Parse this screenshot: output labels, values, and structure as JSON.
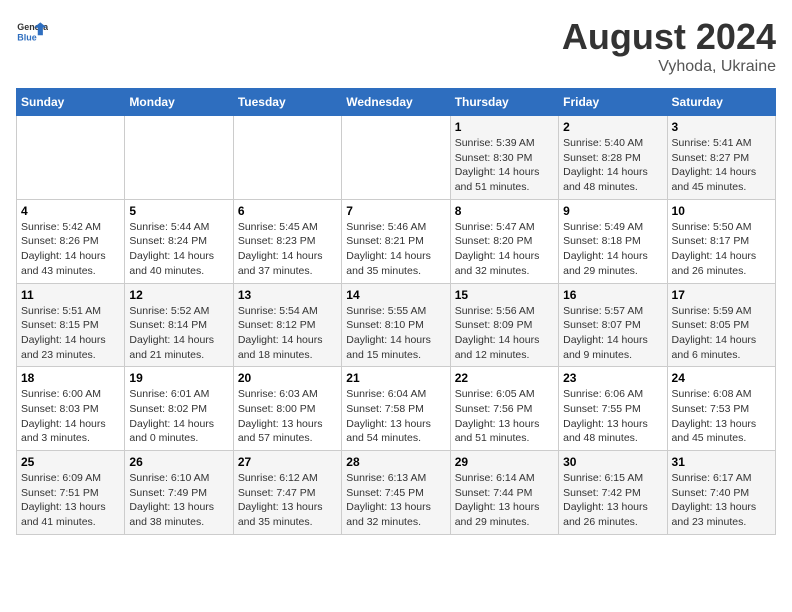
{
  "header": {
    "title": "August 2024",
    "subtitle": "Vyhoda, Ukraine",
    "logo_line1": "General",
    "logo_line2": "Blue"
  },
  "days_of_week": [
    "Sunday",
    "Monday",
    "Tuesday",
    "Wednesday",
    "Thursday",
    "Friday",
    "Saturday"
  ],
  "weeks": [
    [
      {
        "day": "",
        "info": ""
      },
      {
        "day": "",
        "info": ""
      },
      {
        "day": "",
        "info": ""
      },
      {
        "day": "",
        "info": ""
      },
      {
        "day": "1",
        "info": "Sunrise: 5:39 AM\nSunset: 8:30 PM\nDaylight: 14 hours\nand 51 minutes."
      },
      {
        "day": "2",
        "info": "Sunrise: 5:40 AM\nSunset: 8:28 PM\nDaylight: 14 hours\nand 48 minutes."
      },
      {
        "day": "3",
        "info": "Sunrise: 5:41 AM\nSunset: 8:27 PM\nDaylight: 14 hours\nand 45 minutes."
      }
    ],
    [
      {
        "day": "4",
        "info": "Sunrise: 5:42 AM\nSunset: 8:26 PM\nDaylight: 14 hours\nand 43 minutes."
      },
      {
        "day": "5",
        "info": "Sunrise: 5:44 AM\nSunset: 8:24 PM\nDaylight: 14 hours\nand 40 minutes."
      },
      {
        "day": "6",
        "info": "Sunrise: 5:45 AM\nSunset: 8:23 PM\nDaylight: 14 hours\nand 37 minutes."
      },
      {
        "day": "7",
        "info": "Sunrise: 5:46 AM\nSunset: 8:21 PM\nDaylight: 14 hours\nand 35 minutes."
      },
      {
        "day": "8",
        "info": "Sunrise: 5:47 AM\nSunset: 8:20 PM\nDaylight: 14 hours\nand 32 minutes."
      },
      {
        "day": "9",
        "info": "Sunrise: 5:49 AM\nSunset: 8:18 PM\nDaylight: 14 hours\nand 29 minutes."
      },
      {
        "day": "10",
        "info": "Sunrise: 5:50 AM\nSunset: 8:17 PM\nDaylight: 14 hours\nand 26 minutes."
      }
    ],
    [
      {
        "day": "11",
        "info": "Sunrise: 5:51 AM\nSunset: 8:15 PM\nDaylight: 14 hours\nand 23 minutes."
      },
      {
        "day": "12",
        "info": "Sunrise: 5:52 AM\nSunset: 8:14 PM\nDaylight: 14 hours\nand 21 minutes."
      },
      {
        "day": "13",
        "info": "Sunrise: 5:54 AM\nSunset: 8:12 PM\nDaylight: 14 hours\nand 18 minutes."
      },
      {
        "day": "14",
        "info": "Sunrise: 5:55 AM\nSunset: 8:10 PM\nDaylight: 14 hours\nand 15 minutes."
      },
      {
        "day": "15",
        "info": "Sunrise: 5:56 AM\nSunset: 8:09 PM\nDaylight: 14 hours\nand 12 minutes."
      },
      {
        "day": "16",
        "info": "Sunrise: 5:57 AM\nSunset: 8:07 PM\nDaylight: 14 hours\nand 9 minutes."
      },
      {
        "day": "17",
        "info": "Sunrise: 5:59 AM\nSunset: 8:05 PM\nDaylight: 14 hours\nand 6 minutes."
      }
    ],
    [
      {
        "day": "18",
        "info": "Sunrise: 6:00 AM\nSunset: 8:03 PM\nDaylight: 14 hours\nand 3 minutes."
      },
      {
        "day": "19",
        "info": "Sunrise: 6:01 AM\nSunset: 8:02 PM\nDaylight: 14 hours\nand 0 minutes."
      },
      {
        "day": "20",
        "info": "Sunrise: 6:03 AM\nSunset: 8:00 PM\nDaylight: 13 hours\nand 57 minutes."
      },
      {
        "day": "21",
        "info": "Sunrise: 6:04 AM\nSunset: 7:58 PM\nDaylight: 13 hours\nand 54 minutes."
      },
      {
        "day": "22",
        "info": "Sunrise: 6:05 AM\nSunset: 7:56 PM\nDaylight: 13 hours\nand 51 minutes."
      },
      {
        "day": "23",
        "info": "Sunrise: 6:06 AM\nSunset: 7:55 PM\nDaylight: 13 hours\nand 48 minutes."
      },
      {
        "day": "24",
        "info": "Sunrise: 6:08 AM\nSunset: 7:53 PM\nDaylight: 13 hours\nand 45 minutes."
      }
    ],
    [
      {
        "day": "25",
        "info": "Sunrise: 6:09 AM\nSunset: 7:51 PM\nDaylight: 13 hours\nand 41 minutes."
      },
      {
        "day": "26",
        "info": "Sunrise: 6:10 AM\nSunset: 7:49 PM\nDaylight: 13 hours\nand 38 minutes."
      },
      {
        "day": "27",
        "info": "Sunrise: 6:12 AM\nSunset: 7:47 PM\nDaylight: 13 hours\nand 35 minutes."
      },
      {
        "day": "28",
        "info": "Sunrise: 6:13 AM\nSunset: 7:45 PM\nDaylight: 13 hours\nand 32 minutes."
      },
      {
        "day": "29",
        "info": "Sunrise: 6:14 AM\nSunset: 7:44 PM\nDaylight: 13 hours\nand 29 minutes."
      },
      {
        "day": "30",
        "info": "Sunrise: 6:15 AM\nSunset: 7:42 PM\nDaylight: 13 hours\nand 26 minutes."
      },
      {
        "day": "31",
        "info": "Sunrise: 6:17 AM\nSunset: 7:40 PM\nDaylight: 13 hours\nand 23 minutes."
      }
    ]
  ]
}
